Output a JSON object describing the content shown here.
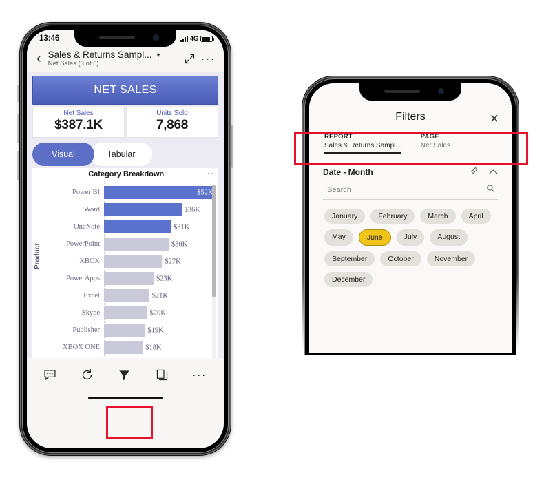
{
  "phone1": {
    "status": {
      "time": "13:46",
      "network": "4G",
      "signal_icon": "signal-bars-icon",
      "battery_icon": "battery-icon"
    },
    "titlebar": {
      "back_icon": "chevron-left-icon",
      "title": "Sales & Returns Sampl...",
      "caret_icon": "chevron-down-icon",
      "subtitle": "Net Sales (3 of 6)",
      "fullscreen_icon": "expand-arrows-icon",
      "more_icon": "ellipsis-icon"
    },
    "banner": {
      "label": "NET SALES"
    },
    "kpis": [
      {
        "label": "Net Sales",
        "value": "$387.1K"
      },
      {
        "label": "Units Sold",
        "value": "7,868"
      }
    ],
    "toggle": {
      "visual": "Visual",
      "tabular": "Tabular",
      "selected": "Visual"
    },
    "visual": {
      "title": "Category Breakdown",
      "more_icon": "ellipsis-icon",
      "yaxis_title": "Product"
    },
    "toolbar": [
      {
        "name": "comment-icon",
        "label": "Comment"
      },
      {
        "name": "refresh-icon",
        "label": "Refresh"
      },
      {
        "name": "filter-funnel-icon",
        "label": "Filters"
      },
      {
        "name": "pages-icon",
        "label": "Pages"
      },
      {
        "name": "ellipsis-icon",
        "label": "More"
      }
    ]
  },
  "chart_data": {
    "type": "bar",
    "title": "Category Breakdown",
    "xlabel": "",
    "ylabel": "Product",
    "orientation": "horizontal",
    "grid": true,
    "categories": [
      "Power BI",
      "Word",
      "OneNote",
      "PowerPoint",
      "XBOX",
      "PowerApps",
      "Excel",
      "Skype",
      "Publisher",
      "XBOX ONE"
    ],
    "values": [
      52,
      36,
      31,
      30,
      27,
      23,
      21,
      20,
      19,
      18
    ],
    "value_labels": [
      "$52K",
      "$36K",
      "$31K",
      "$30K",
      "$27K",
      "$23K",
      "$21K",
      "$20K",
      "$19K",
      "$18K"
    ],
    "highlighted": [
      true,
      true,
      true,
      false,
      false,
      false,
      false,
      false,
      false,
      false
    ],
    "colors": {
      "highlight": "#5b72cd",
      "muted": "#cac9da"
    },
    "xlim": [
      0,
      55
    ]
  },
  "phone2": {
    "header": {
      "title": "Filters",
      "close_icon": "close-icon"
    },
    "scopes": [
      {
        "key": "REPORT",
        "value": "Sales & Returns Sampl...",
        "active": true
      },
      {
        "key": "PAGE",
        "value": "Net Sales",
        "active": false
      }
    ],
    "filter_card": {
      "title": "Date - Month",
      "clear_icon": "eraser-icon",
      "collapse_icon": "chevron-up-icon",
      "search_placeholder": "Search",
      "search_icon": "search-icon",
      "chips": [
        {
          "label": "January",
          "selected": false
        },
        {
          "label": "February",
          "selected": false
        },
        {
          "label": "March",
          "selected": false
        },
        {
          "label": "April",
          "selected": false
        },
        {
          "label": "May",
          "selected": false
        },
        {
          "label": "June",
          "selected": true
        },
        {
          "label": "July",
          "selected": false
        },
        {
          "label": "August",
          "selected": false
        },
        {
          "label": "September",
          "selected": false
        },
        {
          "label": "October",
          "selected": false
        },
        {
          "label": "November",
          "selected": false
        },
        {
          "label": "December",
          "selected": false
        }
      ]
    }
  },
  "annotations": {
    "highlight_color": "#e8112d",
    "boxes": [
      {
        "name": "filter-button-highlight"
      },
      {
        "name": "filter-scope-highlight"
      }
    ]
  }
}
